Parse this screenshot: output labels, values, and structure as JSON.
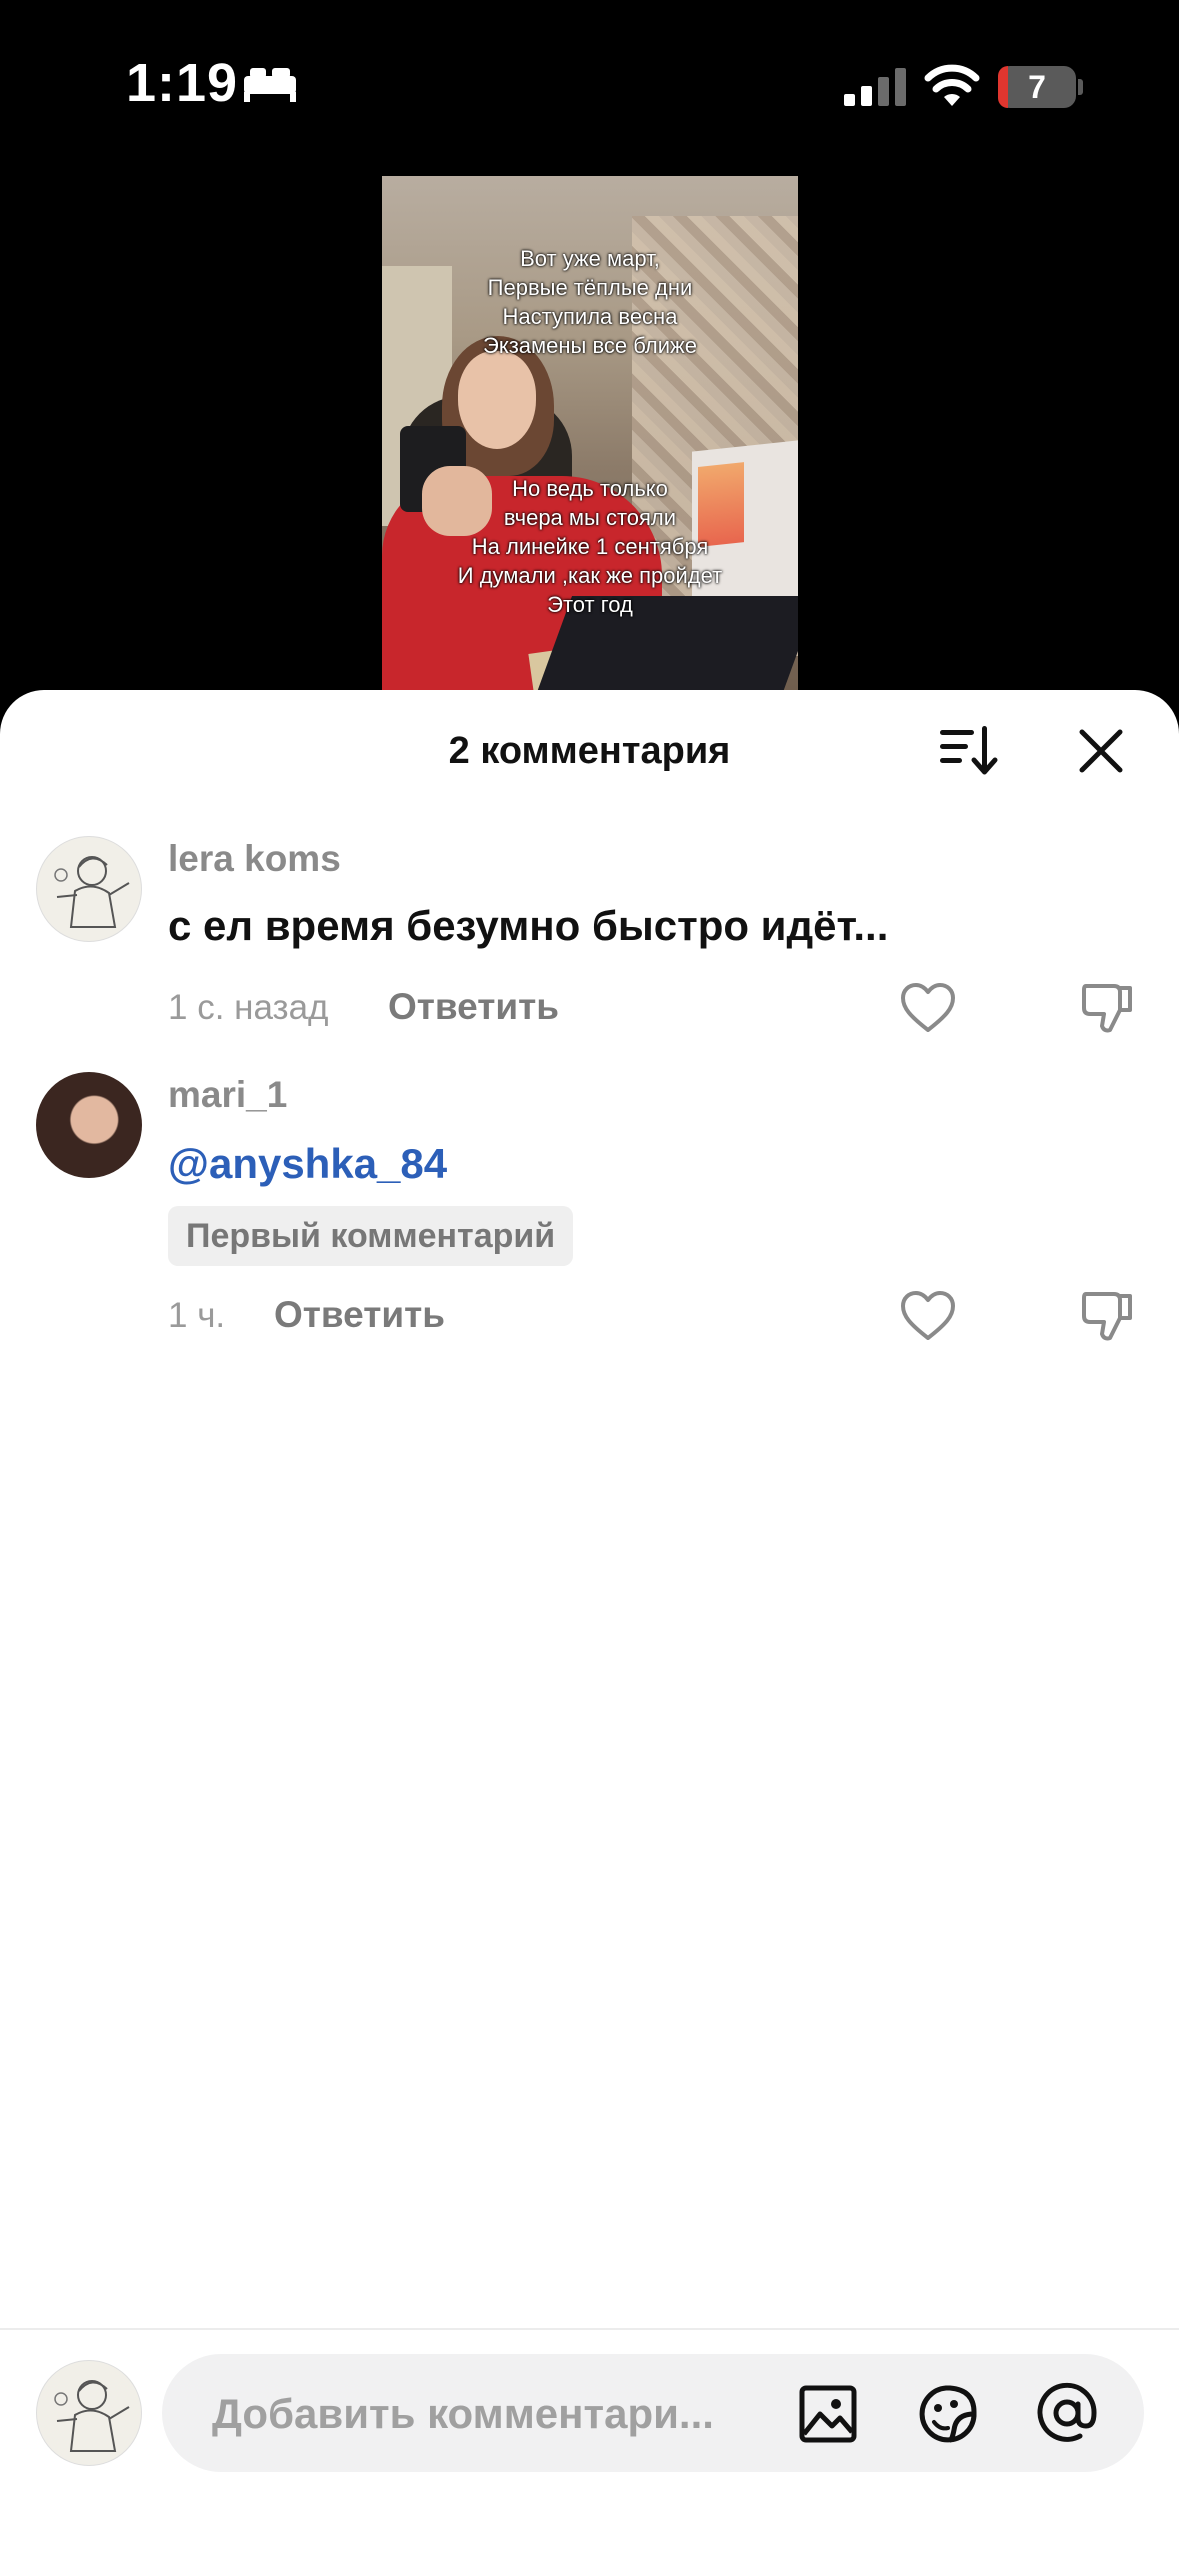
{
  "status_bar": {
    "time": "1:19",
    "battery": "7",
    "icons": [
      "bed-icon",
      "signal-icon",
      "wifi-icon",
      "battery-icon"
    ]
  },
  "video": {
    "overlay_top": [
      "Вот уже март,",
      "Первые тёплые дни",
      "Наступила весна",
      "Экзамены все ближе"
    ],
    "overlay_bottom": [
      "Но ведь только",
      "вчера мы стояли",
      "На линейке 1 сентября",
      "И думали ,как же пройдет",
      "Этот год"
    ]
  },
  "sheet": {
    "title": "2 комментария",
    "icons": [
      "sort-icon",
      "close-icon"
    ]
  },
  "comments": [
    {
      "username": "lera koms",
      "text": "с ел время безумно быстро идёт...",
      "time": "1 с. назад",
      "reply": "Ответить"
    },
    {
      "username": "mari_1",
      "text": "@anyshka_84",
      "badge": "Первый комментарий",
      "time": "1 ч.",
      "reply": "Ответить"
    }
  ],
  "composer": {
    "placeholder": "Добавить комментари...",
    "icons": [
      "image-icon",
      "emoji-icon",
      "at-icon"
    ]
  },
  "colors": {
    "mention": "#2c5fb8",
    "background": "#ffffff",
    "status_bar_bg": "#000000"
  }
}
